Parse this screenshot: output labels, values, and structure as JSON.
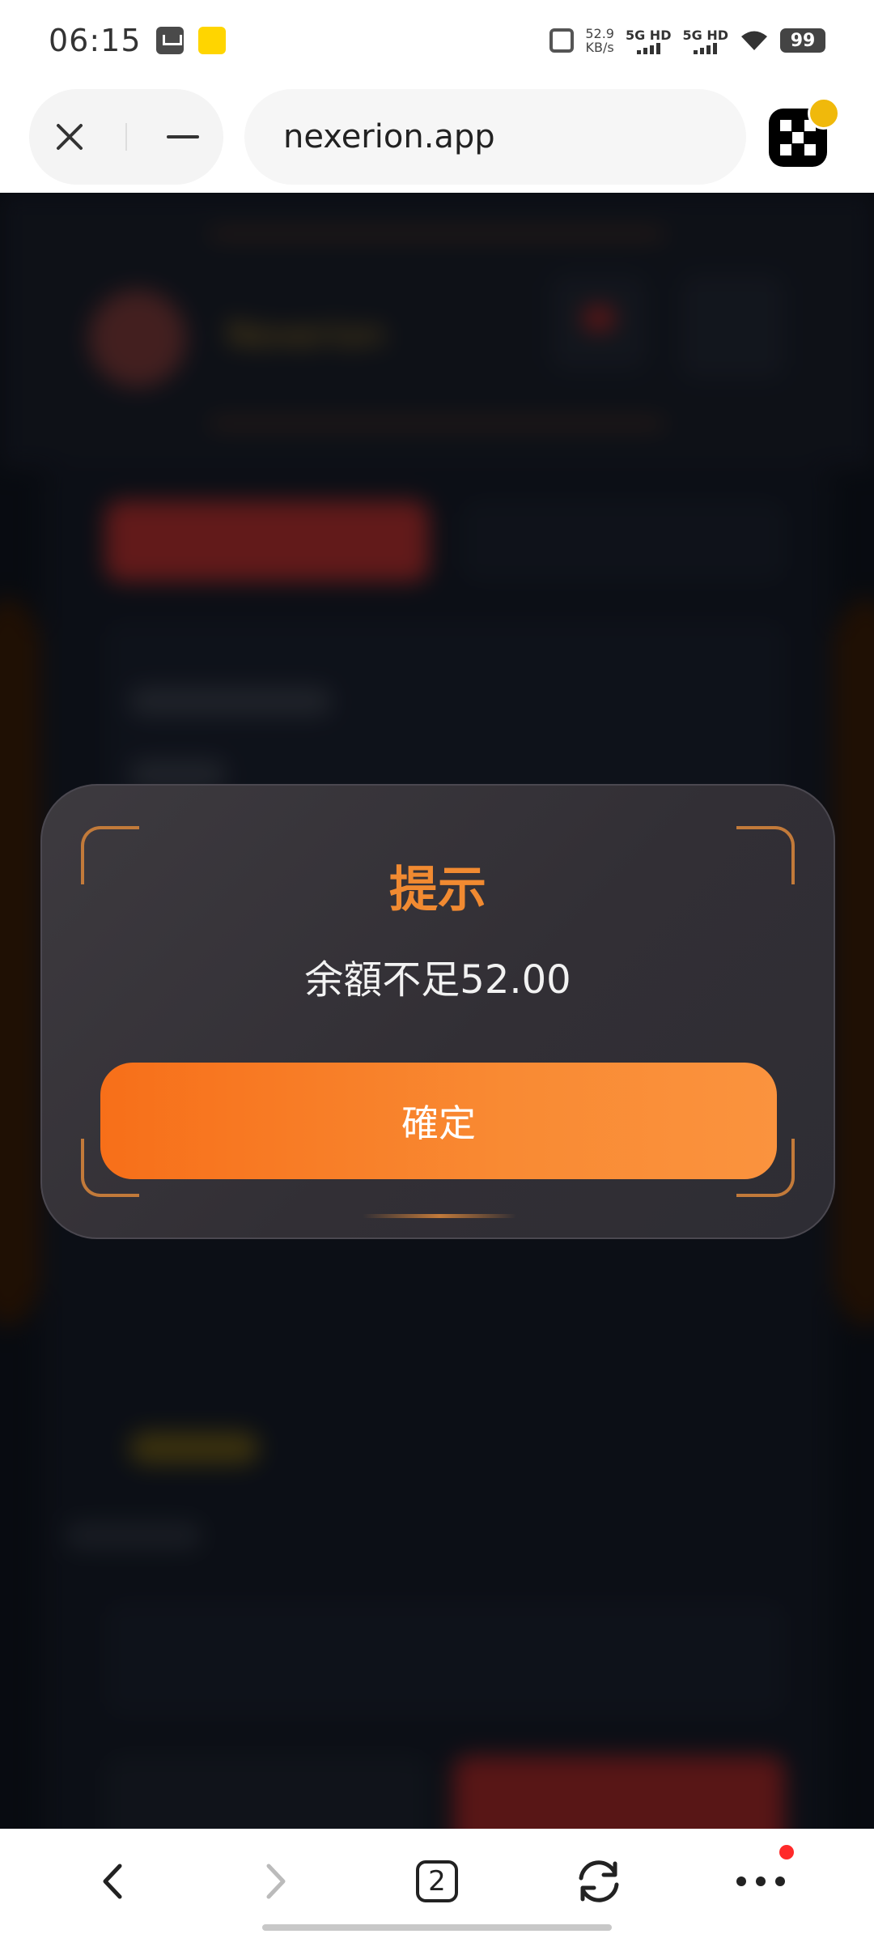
{
  "status_bar": {
    "time": "06:15",
    "net_speed_value": "52.9",
    "net_speed_unit": "KB/s",
    "sim1_label": "5G HD",
    "sim2_label": "5G HD",
    "battery": "99"
  },
  "browser": {
    "url": "nexerion.app",
    "tab_count": "2"
  },
  "background": {
    "header_title": "Nexerion"
  },
  "dialog": {
    "title": "提示",
    "message": "余額不足52.00",
    "confirm_label": "確定"
  },
  "colors": {
    "accent": "#f18a31",
    "button_start": "#f76f19",
    "button_end": "#fa933e"
  },
  "icons": {
    "close": "close-icon",
    "minimize": "minimize-icon",
    "back": "chevron-left-icon",
    "forward": "chevron-right-icon",
    "refresh": "refresh-icon",
    "more": "more-dots-icon"
  }
}
